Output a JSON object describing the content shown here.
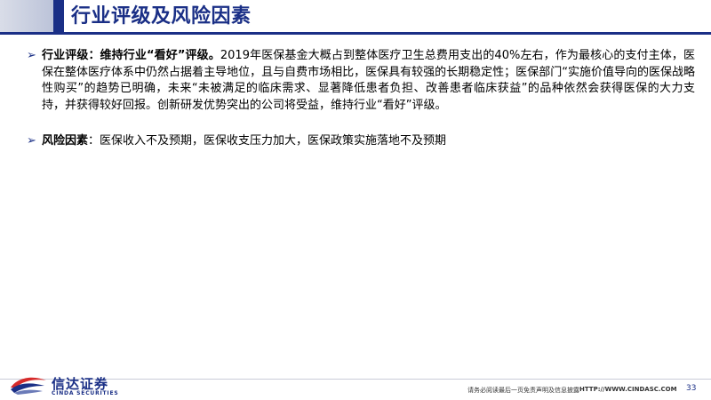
{
  "header": {
    "title": "行业评级及风险因素"
  },
  "bullets": [
    {
      "marker": "➢",
      "label": "行业评级：维持行业“看好”评级。",
      "text": "2019年医保基金大概占到整体医疗卫生总费用支出的40%左右，作为最核心的支付主体，医保在整体医疗体系中仍然占据着主导地位，且与自费市场相比，医保具有较强的长期稳定性；医保部门“实施价值导向的医保战略性购买”的趋势已明确，未来“未被满足的临床需求、显著降低患者负担、改善患者临床获益”的品种依然会获得医保的大力支持，并获得较好回报。创新研发优势突出的公司将受益，维持行业“看好”评级。"
    },
    {
      "marker": "➢",
      "label": "风险因素",
      "text": "：医保收入不及预期，医保收支压力加大，医保政策实施落地不及预期"
    }
  ],
  "footer": {
    "logo_cn": "信达证券",
    "logo_en": "CINDA SECURITIES",
    "disclaimer": "请务必阅读最后一页免责声明及信息披露",
    "url": "HTTP://WWW.CINDASC.COM",
    "page_number": "33"
  },
  "colors": {
    "brand": "#1a2f86",
    "logo_red": "#d62b2b",
    "logo_blue": "#1a2f86"
  }
}
